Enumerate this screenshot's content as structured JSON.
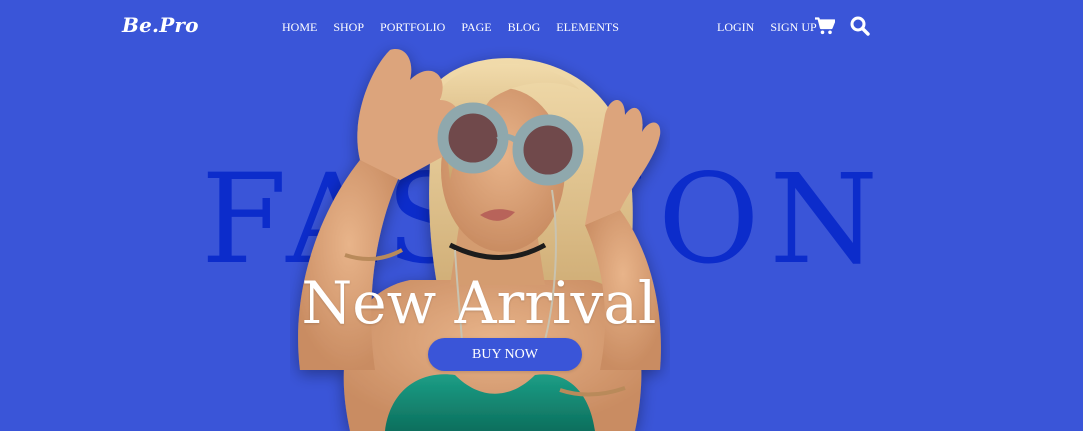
{
  "header": {
    "logo": "Be.Pro",
    "nav": [
      {
        "label": "HOME"
      },
      {
        "label": "SHOP"
      },
      {
        "label": "PORTFOLIO"
      },
      {
        "label": "PAGE"
      },
      {
        "label": "BLOG"
      },
      {
        "label": "ELEMENTS"
      }
    ],
    "auth": {
      "login": "LOGIN",
      "signup": "SIGN UP"
    },
    "icons": [
      "cart-icon",
      "search-icon"
    ]
  },
  "hero": {
    "background_word": "FASHION",
    "headline": "New Arrival",
    "button_label": "BUY NOW"
  },
  "colors": {
    "background": "#3a55d8",
    "background_word": "#0c2ccb",
    "text": "#ffffff",
    "button": "#3a55d8"
  }
}
